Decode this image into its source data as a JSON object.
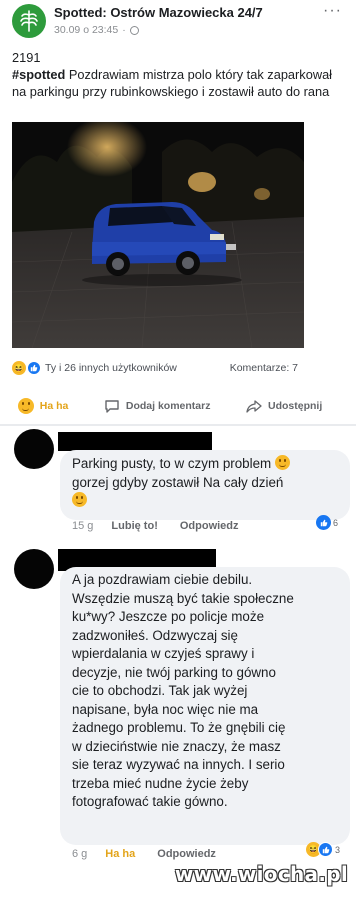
{
  "post": {
    "page_name": "Spotted: Ostrów Mazowiecka 24/7",
    "time": "30.09 o 23:45",
    "more_label": "···",
    "text_line1_number": "2191",
    "hashtag": "#spotted",
    "text_body": " Pozdrawiam mistrza polo który tak zaparkował na parkingu przy rubinkowskiego i zostawił auto do rana",
    "reactions_text": "Ty i 26 innych użytkowników",
    "comments_text": "Komentarze: 7",
    "actions": {
      "haha": "Ha ha",
      "comment": "Dodaj komentarz",
      "share": "Udostępnij"
    }
  },
  "comments": [
    {
      "text": "Parking pusty, to w czym problem",
      "text2": "gorzej gdyby zostawił Na cały dzień",
      "time": "15 g",
      "like_label": "Lubię to!",
      "reply_label": "Odpowiedz",
      "reaction_count": "6"
    },
    {
      "lines": [
        "A ja pozdrawiam ciebie debilu.",
        "Wszędzie muszą być takie społeczne",
        "ku*wy? Jeszcze po policje może",
        "zadzwoniłeś. Odzwyczaj się",
        "wpierdalania w czyjeś sprawy i",
        "decyzje, nie twój parking to gówno",
        "cie to obchodzi. Tak jak wyżej",
        "napisane, była noc więc nie ma",
        "żadnego problemu. To że gnębili cię",
        "w dzieciństwie nie znaczy, że masz",
        "sie teraz wyzywać na innych. I serio",
        "trzeba mieć nudne życie żeby",
        "fotografować takie gówno."
      ],
      "time": "6 g",
      "like_label": "Ha ha",
      "reply_label": "Odpowiedz",
      "reaction_count": "3"
    }
  ],
  "watermark": "www.wiocha.pl",
  "colors": {
    "brand_green": "#2e9b3c",
    "fb_blue": "#1877f2",
    "haha_yellow": "#e3a41a",
    "bubble_gray": "#f0f2f5"
  },
  "icons": [
    "page-logo-icon",
    "globe-icon",
    "more-icon",
    "haha-reaction-icon",
    "like-reaction-icon",
    "comment-icon",
    "share-icon"
  ]
}
